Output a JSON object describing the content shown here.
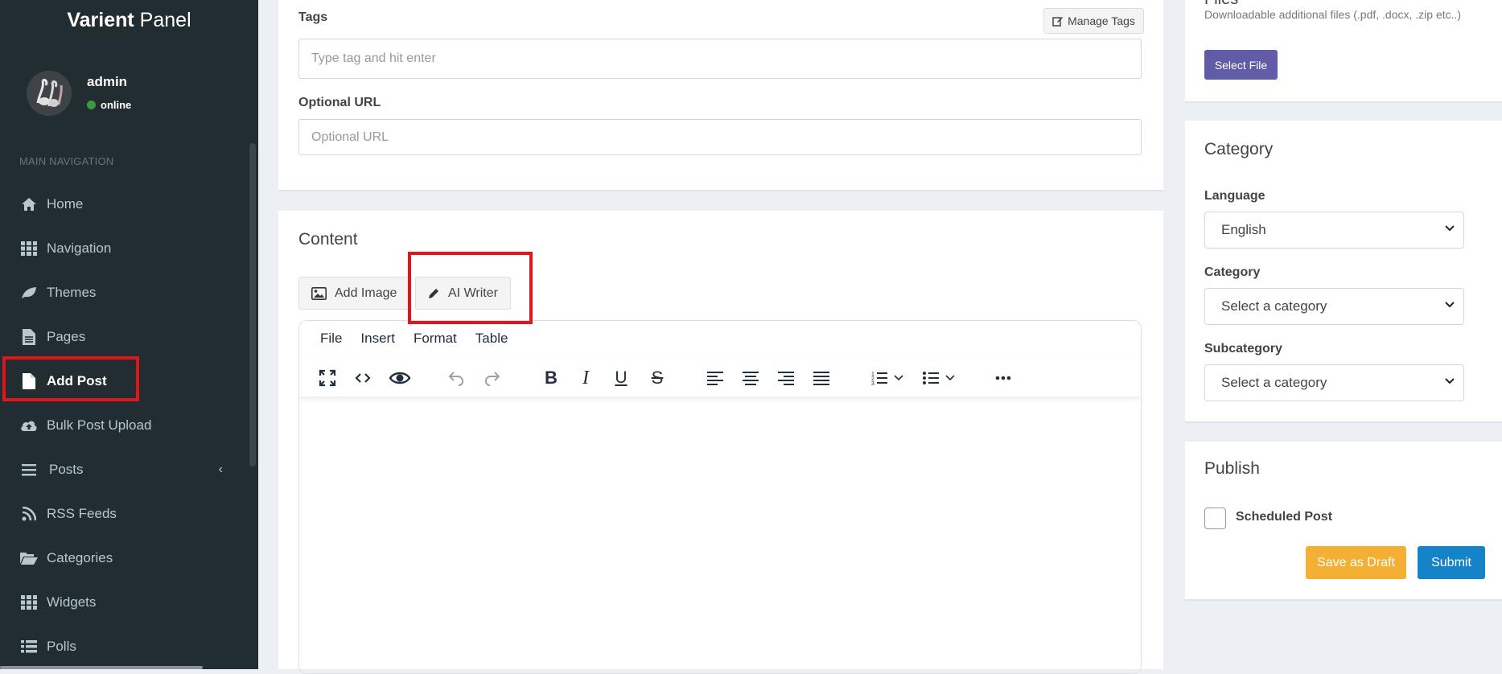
{
  "brand": {
    "bold": "Varient",
    "light": " Panel"
  },
  "user": {
    "name": "admin",
    "status": "online"
  },
  "sidebar": {
    "header": "MAIN NAVIGATION",
    "items": [
      {
        "label": "Home",
        "icon": "home-icon"
      },
      {
        "label": "Navigation",
        "icon": "grid-icon"
      },
      {
        "label": "Themes",
        "icon": "leaf-icon"
      },
      {
        "label": "Pages",
        "icon": "file-text-icon"
      },
      {
        "label": "Add Post",
        "icon": "file-icon",
        "active": true
      },
      {
        "label": "Bulk Post Upload",
        "icon": "cloud-upload-icon"
      },
      {
        "label": "Posts",
        "icon": "bars-icon",
        "chevron": "‹"
      },
      {
        "label": "RSS Feeds",
        "icon": "rss-icon"
      },
      {
        "label": "Categories",
        "icon": "folder-open-icon"
      },
      {
        "label": "Widgets",
        "icon": "grid-icon"
      },
      {
        "label": "Polls",
        "icon": "list-icon"
      }
    ]
  },
  "form": {
    "tags_label": "Tags",
    "manage_tags": "Manage Tags",
    "tags_placeholder": "Type tag and hit enter",
    "url_label": "Optional URL",
    "url_placeholder": "Optional URL"
  },
  "content": {
    "title": "Content",
    "add_image": "Add Image",
    "ai_writer": "AI Writer",
    "menu": [
      "File",
      "Insert",
      "Format",
      "Table"
    ]
  },
  "files": {
    "title": "Files",
    "note": "Downloadable additional files (.pdf, .docx, .zip etc..)",
    "select_button": "Select File"
  },
  "category": {
    "title": "Category",
    "language_label": "Language",
    "language_value": "English",
    "category_label": "Category",
    "category_value": "Select a category",
    "subcategory_label": "Subcategory",
    "subcategory_value": "Select a category"
  },
  "publish": {
    "title": "Publish",
    "scheduled_label": "Scheduled Post",
    "draft_button": "Save as Draft",
    "submit_button": "Submit"
  },
  "colors": {
    "sidebar": "#222d32",
    "highlight": "#e3141c",
    "primary": "#1583c8",
    "warning": "#f3b034",
    "purple": "#605ca8"
  }
}
